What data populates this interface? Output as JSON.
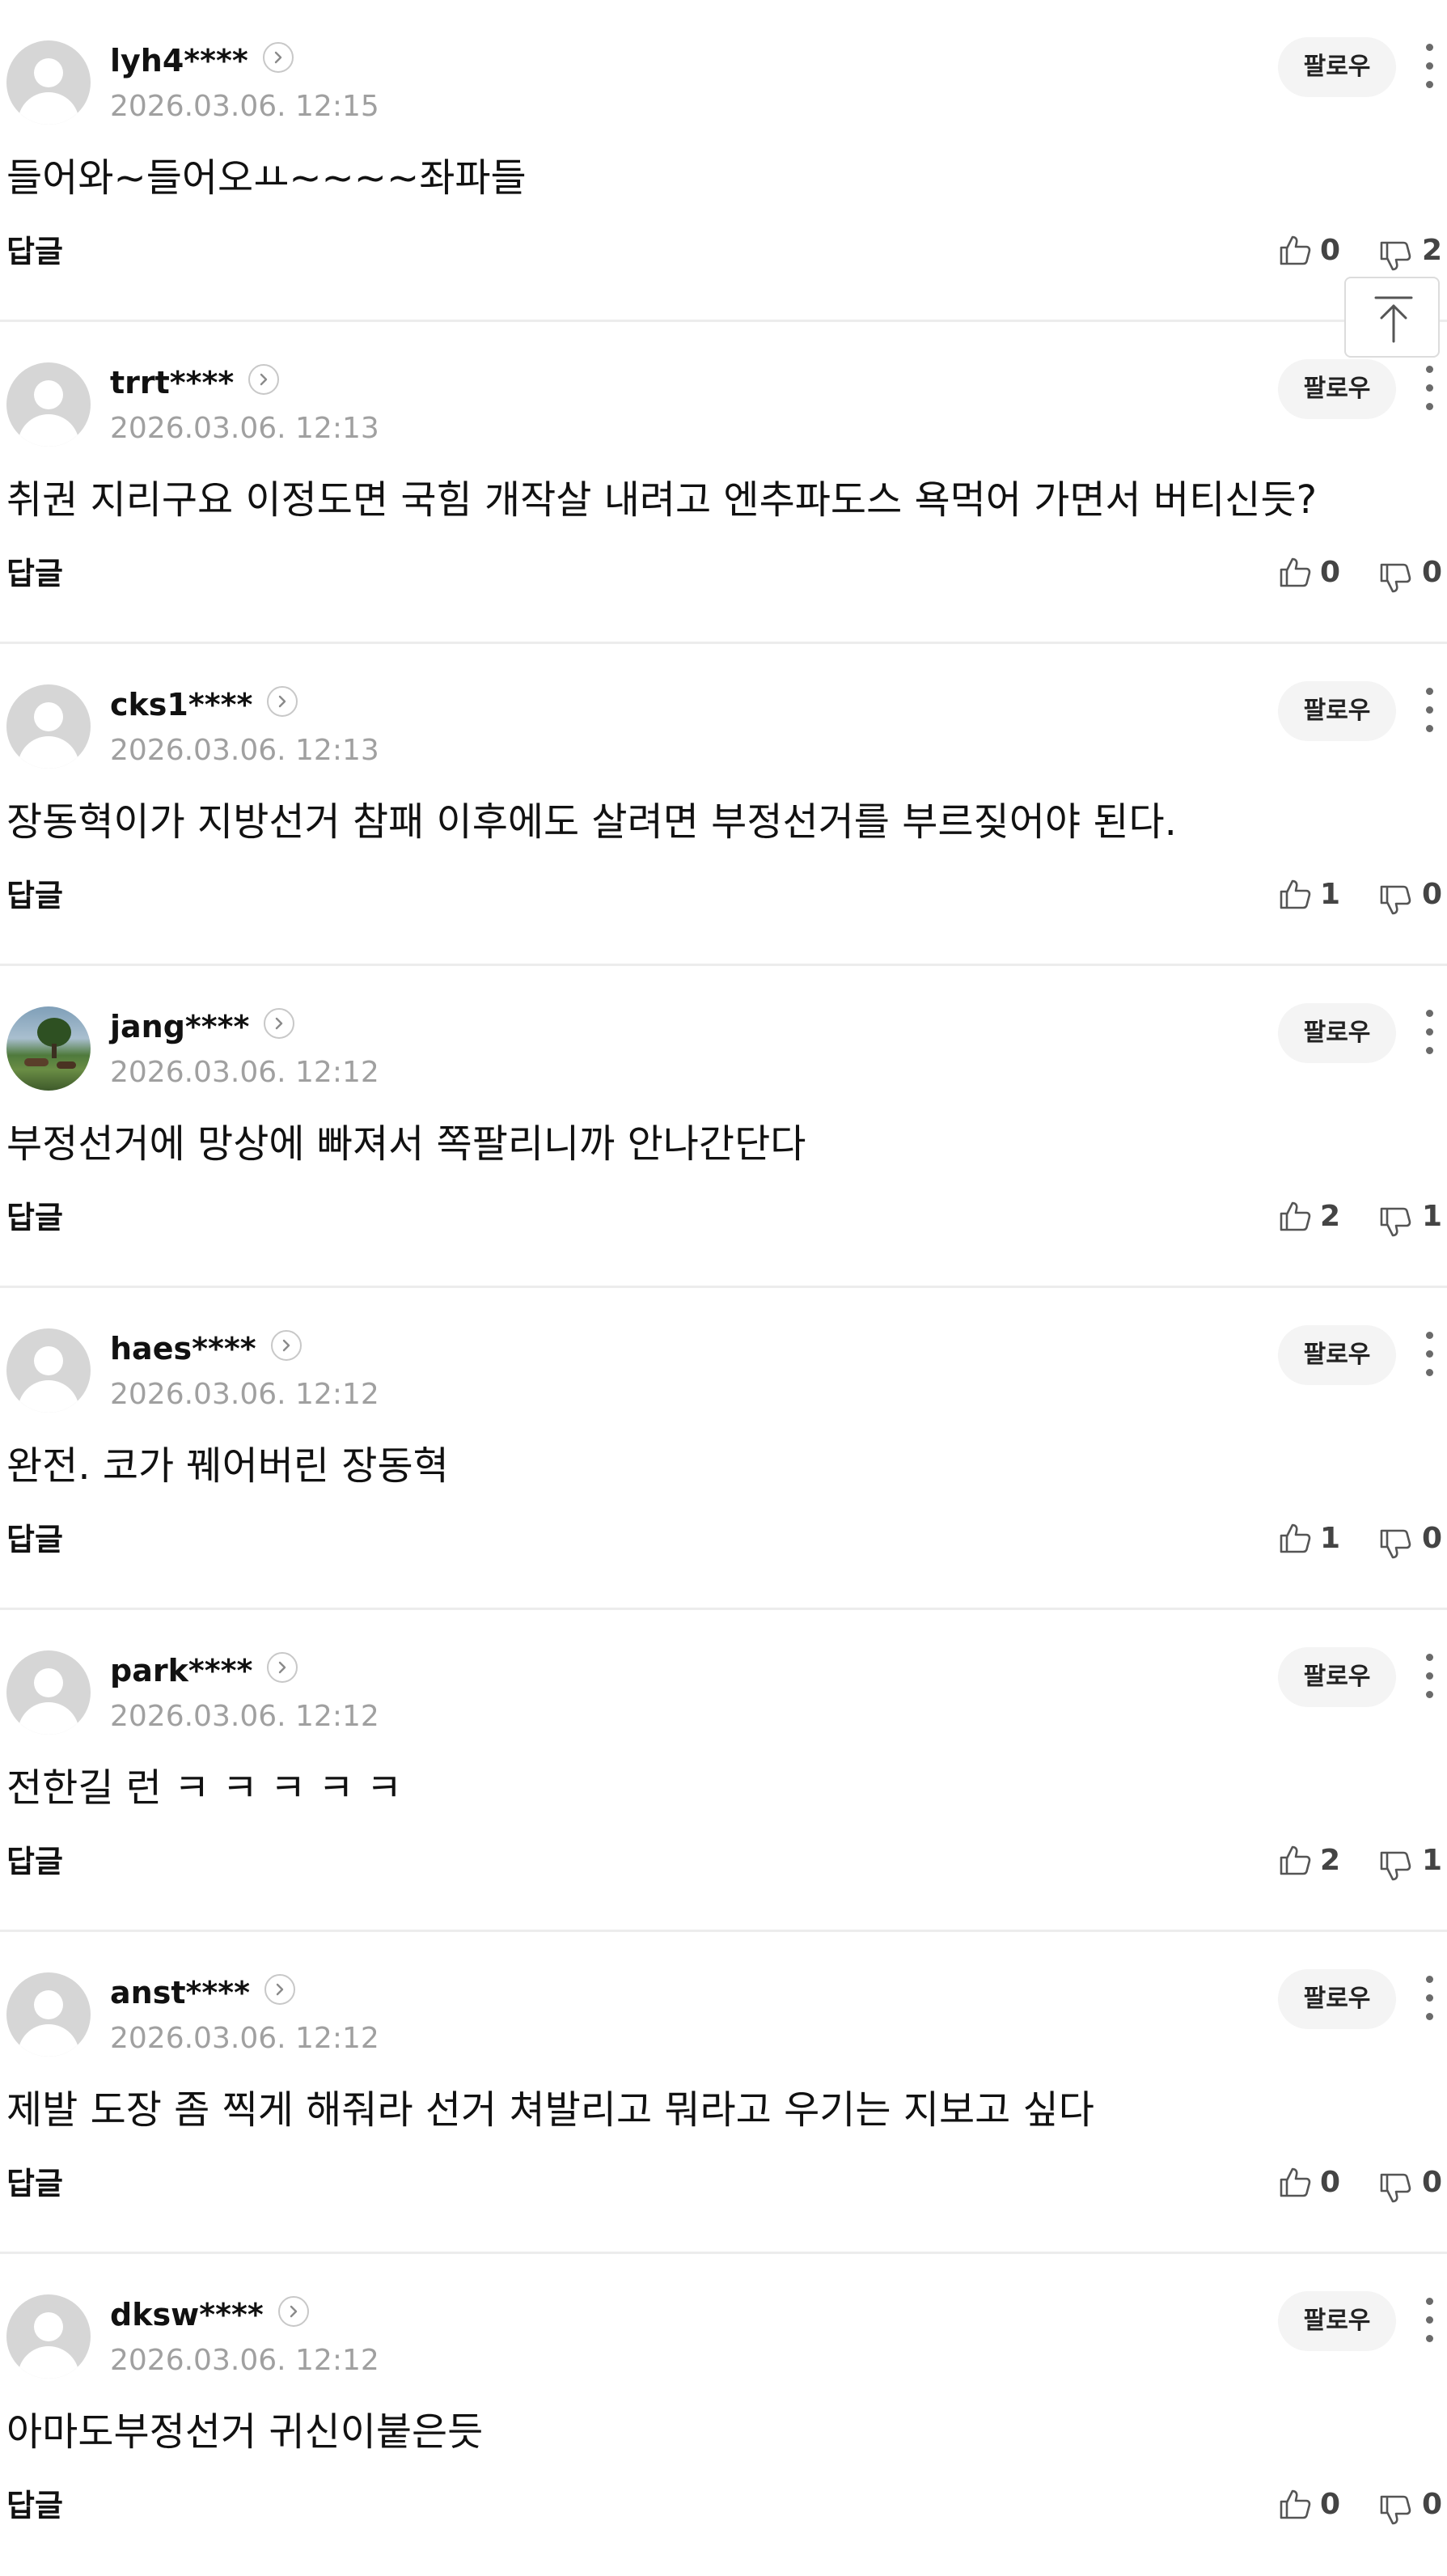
{
  "ui": {
    "follow_label": "팔로우",
    "reply_label": "답글"
  },
  "icons": {
    "top": "arrow-up-to-top-icon",
    "like": "thumbs-up-icon",
    "dislike": "thumbs-down-icon",
    "more": "vertical-ellipsis-icon",
    "profile": "chevron-right-icon"
  },
  "comments": [
    {
      "nickname": "lyh4****",
      "timestamp": "2026.03.06. 12:15",
      "content": "들어와~들어오ㅛ~~~~좌파들",
      "likes": "0",
      "dislikes": "2",
      "avatar": "default"
    },
    {
      "nickname": "trrt****",
      "timestamp": "2026.03.06. 12:13",
      "content": "취권 지리구요 이정도면 국힘 개작살 내려고 엔추파도스 욕먹어 가면서 버티신듯?",
      "likes": "0",
      "dislikes": "0",
      "avatar": "default"
    },
    {
      "nickname": "cks1****",
      "timestamp": "2026.03.06. 12:13",
      "content": "장동혁이가 지방선거 참패 이후에도 살려면 부정선거를 부르짖어야 된다.",
      "likes": "1",
      "dislikes": "0",
      "avatar": "default"
    },
    {
      "nickname": "jang****",
      "timestamp": "2026.03.06. 12:12",
      "content": "부정선거에 망상에 빠져서 쪽팔리니까 안나간단다",
      "likes": "2",
      "dislikes": "1",
      "avatar": "photo"
    },
    {
      "nickname": "haes****",
      "timestamp": "2026.03.06. 12:12",
      "content": "완전. 코가 꿰어버린 장동혁",
      "likes": "1",
      "dislikes": "0",
      "avatar": "default"
    },
    {
      "nickname": "park****",
      "timestamp": "2026.03.06. 12:12",
      "content": "전한길 런 ㅋ ㅋ ㅋ ㅋ ㅋ",
      "likes": "2",
      "dislikes": "1",
      "avatar": "default"
    },
    {
      "nickname": "anst****",
      "timestamp": "2026.03.06. 12:12",
      "content": "제발 도장 좀 찍게 해줘라 선거 쳐발리고 뭐라고 우기는 지보고 싶다",
      "likes": "0",
      "dislikes": "0",
      "avatar": "default"
    },
    {
      "nickname": "dksw****",
      "timestamp": "2026.03.06. 12:12",
      "content": "아마도부정선거 귀신이붙은듯",
      "likes": "0",
      "dislikes": "0",
      "avatar": "default"
    }
  ]
}
